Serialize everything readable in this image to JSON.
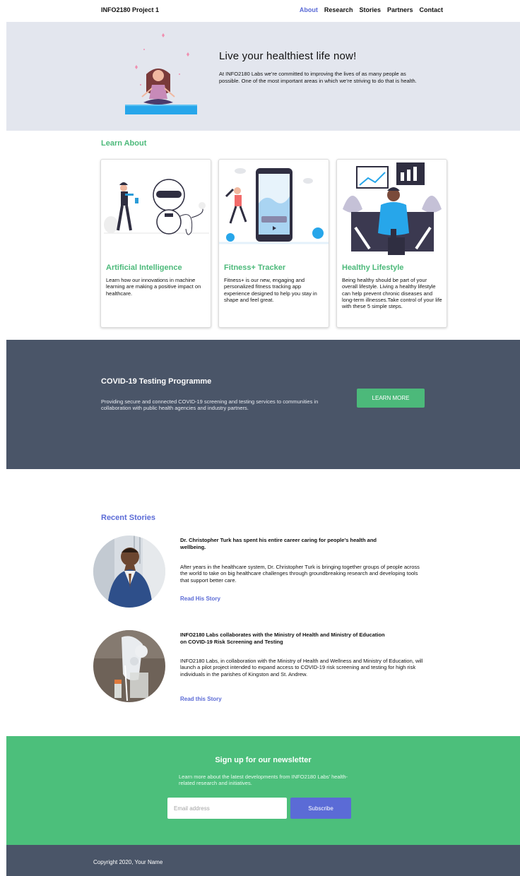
{
  "nav": {
    "brand": "INFO2180 Project 1",
    "links": [
      "About",
      "Research",
      "Stories",
      "Partners",
      "Contact"
    ],
    "active": "About"
  },
  "hero": {
    "title": "Live  your healthiest life now!",
    "text": "At INFO2180 Labs we’re committed to improving the lives of as many people as possible. One of the most important areas in which we’re striving to do that is health."
  },
  "learn": {
    "heading": "Learn About",
    "cards": [
      {
        "title": "Artificial Intelligence",
        "text": "Learn how our innovations in machine learning are making a positive impact on healthcare."
      },
      {
        "title": "Fitness+ Tracker",
        "text": "Fitness+ is our new, engaging and personalized fitness tracking app experience designed to help you stay in shape and feel great."
      },
      {
        "title": "Healthy Lifestyle",
        "text": "Being healthy should be part of your overall lifestyle. Living a healthy lifestyle can help prevent chronic diseases and long-term illnesses.Take control of your life with these 5 simple steps."
      }
    ]
  },
  "covid": {
    "title": "COVID-19 Testing Programme",
    "text": "Providing secure and connected COVID-19 screening and testing services to communities in collaboration with public health agencies and industry partners.",
    "button": "LEARN MORE"
  },
  "stories": {
    "heading": "Recent Stories",
    "items": [
      {
        "title": "Dr. Christopher Turk has spent his entire career caring for people’s health and wellbeing.",
        "text": "After years in the healthcare system, Dr. Christopher Turk is bringing together groups of people across the world to take on big healthcare challenges through groundbreaking research and developing tools that support better care.",
        "link": "Read His Story"
      },
      {
        "title": "INFO2180 Labs collaborates with the Ministry of Health and Ministry of Education on COVID-19 Risk Screening and Testing",
        "text": "INFO2180 Labs, in collaboration with the Ministry of Health and Wellness and Ministry of Education, will launch a pilot project intended to expand access to COVID-19 risk screening and testing for high risk individuals in the parishes of Kingston and St. Andrew.",
        "link": "Read this Story"
      }
    ]
  },
  "newsletter": {
    "title": "Sign up for our newsletter",
    "text": "Learn more about the latest developments from INFO2180 Labs’ health-related research and initiatives.",
    "placeholder": "Email address",
    "button": "Subscribe"
  },
  "footer": {
    "text": "Copyright 2020, Your Name"
  },
  "colors": {
    "accent_blue": "#5b6bd6",
    "accent_green": "#4cb97a",
    "dark_band": "#4a5568",
    "hero_bg": "#e3e6ee"
  }
}
